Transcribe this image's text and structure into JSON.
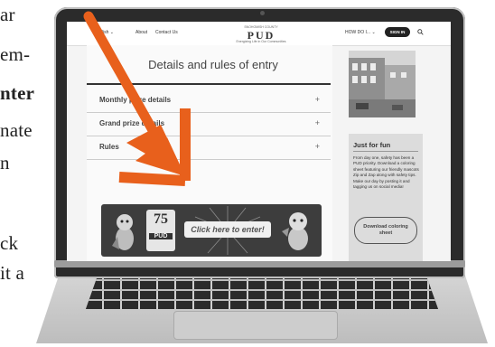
{
  "side_text": [
    "ar",
    "em-",
    "nter",
    "nate",
    "n",
    "ck",
    "it a"
  ],
  "topbar": {
    "language": "English ⌄",
    "about": "About",
    "contact": "Contact Us",
    "brand_small": "SNOHOMISH COUNTY",
    "brand": "PUD",
    "brand_tag": "Energizing Life in Our Communities",
    "how_do_i": "HOW DO I... ⌄",
    "sign_in": "SIGN IN"
  },
  "main": {
    "title": "Details and rules of entry",
    "accordion": [
      {
        "label": "Monthly prize details"
      },
      {
        "label": "Grand prize details"
      },
      {
        "label": "Rules"
      }
    ],
    "banner": {
      "badge_number": "75",
      "badge_pud": "PUD",
      "cta": "Click here to enter!"
    }
  },
  "sidebar": {
    "fun_title": "Just for fun",
    "fun_body": "From day one, safety has been a PUD priority. Download a coloring sheet featuring our friendly mascots Zip and Zap along with safety tips. Make our day by posting it and tagging us on social media!",
    "fun_button": "Download coloring sheet"
  },
  "colors": {
    "arrow": "#e8601c",
    "banner_bg": "#3d3d3d"
  }
}
